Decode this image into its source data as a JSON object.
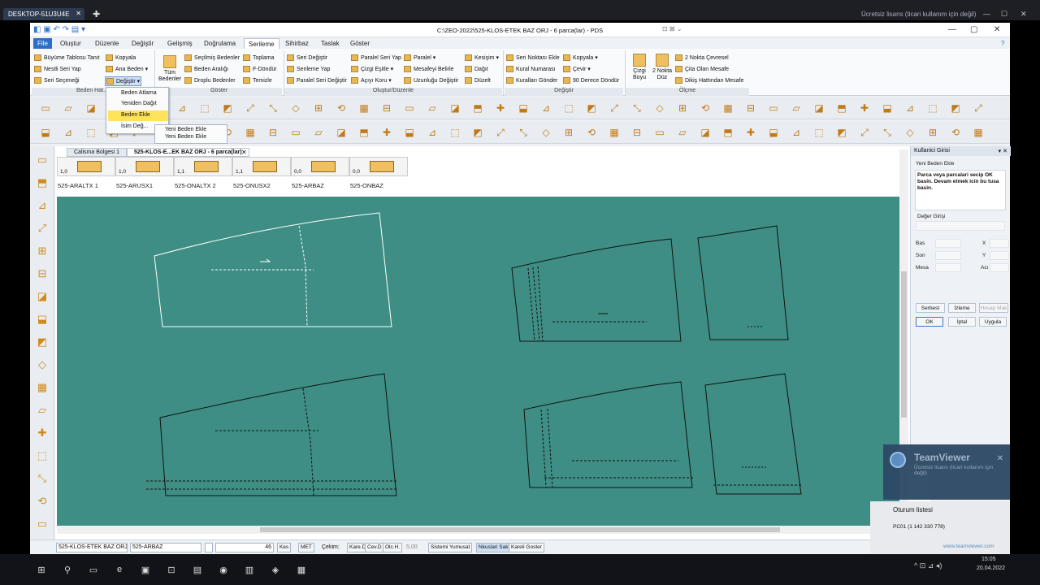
{
  "teamviewer_bar": {
    "tab_label": "DESKTOP-51U3U4E",
    "tab_close": "✕",
    "new_tab": "✚",
    "license_text": "Ücretsiz lisans (ticari kullanım için değil)",
    "controls": [
      "—",
      "☐",
      "✕"
    ]
  },
  "app": {
    "title": "C:\\ZEO-2022\\525-KLOS-ETEK BAZ ORJ - 6 parca(lar) - PDS",
    "quick_access": "◧ ▣ ↶ ↷ ▤ ▾",
    "mdi_controls": "⊡ ⊠ ⌄",
    "window_controls": [
      "—",
      "▢",
      "✕"
    ]
  },
  "menu": {
    "tabs": [
      "File",
      "Oluştur",
      "Düzenle",
      "Değiştir",
      "Gelişmiş",
      "Doğrulama",
      "Serileme",
      "Sihirbaz",
      "Taslak",
      "Göster"
    ],
    "active": "Serileme",
    "help": "?"
  },
  "ribbon": {
    "col1": [
      "Büyüme Tablosu Tanıt",
      "Nestli Seri Yap",
      "Seri Seçeneği"
    ],
    "col2": [
      "Kopyala",
      "Ana Beden ▾",
      "Değiştir ▾"
    ],
    "group_beden": "Beden Hat...",
    "tum_bedenler": "Tüm Bedenler",
    "col3": [
      "Seçilmiş Bedenler",
      "Beden Aralığı",
      "Droplu Bedenler"
    ],
    "col4": [
      "Toplama",
      "F-Döndür",
      "Temizle"
    ],
    "group_goster": "Göster",
    "col5": [
      "Seri Değiştir",
      "Serileme Yap",
      "Paralel Seri Değiştir"
    ],
    "col6": [
      "Paralel Seri Yap",
      "Çizgi Eşitle ▾",
      "Açıyı Koru ▾"
    ],
    "col7": [
      "Paralel ▾",
      "Mesafeyi Belirle",
      "Uzunluğu Değiştir"
    ],
    "col8": [
      "Kesişim ▾",
      "Dağıt",
      "Düzelt"
    ],
    "group_olustur": "Oluştur/Düzenle",
    "col9": [
      "Seri Noktası Ekle",
      "Kural Numarası",
      "Kuralları Gönder"
    ],
    "col10": [
      "Kopyala ▾",
      "Çevir ▾",
      "90 Derece Döndür"
    ],
    "group_degistir": "Değiştir",
    "cizgi_boyu": "Çizgi Boyu",
    "iki_nokta_duz": "2 Nokta Düz",
    "col11": [
      "2 Nokta Çevresel",
      "Çita Olan Mesafe",
      "Dikiş Hattından Mesafe"
    ],
    "group_olcme": "Ölçme"
  },
  "dropdown": {
    "items": [
      "Beden Atlama",
      "Yeniden Dağıt",
      "Beden Ekle",
      "İsim Değ..."
    ],
    "highlighted": 2,
    "submenu": [
      "Yeni Beden Ekle",
      "Yeni Beden Ekle"
    ]
  },
  "document": {
    "tabs": [
      "Calisma Bolgesi 1",
      "525-KLOS-E...EK BAZ ORJ - 6 parca(lar)"
    ],
    "close": "✕",
    "pieces": [
      {
        "count": "1,0",
        "name": "525-ARALTX 1"
      },
      {
        "count": "1,0",
        "name": "525-ARUSX1"
      },
      {
        "count": "1,1",
        "name": "525-ONALTX 2"
      },
      {
        "count": "1,1",
        "name": "525-ONUSX2"
      },
      {
        "count": "0,0",
        "name": "525-ARBAZ"
      },
      {
        "count": "0,0",
        "name": "525-ONBAZ"
      }
    ]
  },
  "statusbar": {
    "f1": "525-KLOS-ETEK BAZ ORJ",
    "f2": "525-ARBAZ",
    "zoom": "46",
    "kes": "Kes",
    "met": "MET",
    "cekim": "Çekim:",
    "b1": "Kare.D",
    "b2": "Cev.D",
    "b3": "Olc.H.",
    "val": "5,00",
    "b4": "Sistemi Yumusat",
    "b5": "Nkuslari Sakl",
    "b6": "Kareli Goster"
  },
  "right_panel": {
    "title": "Kullanici Girisi",
    "sub": "Yeni Beden Ekle",
    "instr": "Parca veya parcalari secip OK basin. Devam etmek icin bu tusa basin.",
    "deger": "Değer Girişi",
    "bas": "Bas",
    "son": "Son",
    "mesa": "Mesa",
    "x": "X",
    "y": "Y",
    "aci": "Acı",
    "btn1": "Serbest",
    "btn2": "İzleme",
    "btn3": "Hesap Mak",
    "ok": "OK",
    "iptal": "İptal",
    "uygula": "Uygula",
    "header_icons": "▾ ✕"
  },
  "teamviewer": {
    "name": "TeamViewer",
    "sub": "Ücretsiz lisans (ticari kullanım için değil)",
    "close": "✕",
    "session_title": "Oturum listesi",
    "session_item": "PC01 (1 142 330 778)",
    "url": "www.teamviewer.com"
  },
  "taskbar": {
    "time": "15:05",
    "date": "20.04.2022",
    "tray": "^ ⊡ ⊿ ◂)"
  }
}
